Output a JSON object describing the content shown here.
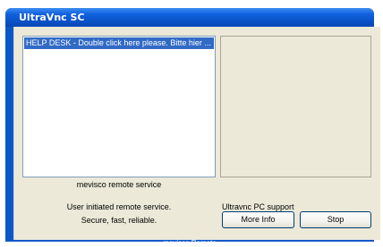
{
  "window": {
    "title": "UltraVnc SC"
  },
  "list": {
    "items": [
      "HELP DESK - Double click here please. Bitte hier ..."
    ]
  },
  "labels": {
    "service": "mevisco remote service",
    "initiated": "User initiated remote service.",
    "secure": "Secure, fast, reliable.",
    "support": "Ultravnc PC support"
  },
  "buttons": {
    "more_info": "More Info",
    "stop": "Stop"
  },
  "footer": {
    "text": "mevisco Remote"
  },
  "colors": {
    "titlebar": "#0a58c8",
    "selection": "#316ac5",
    "dialog_face": "#ece9d8"
  }
}
